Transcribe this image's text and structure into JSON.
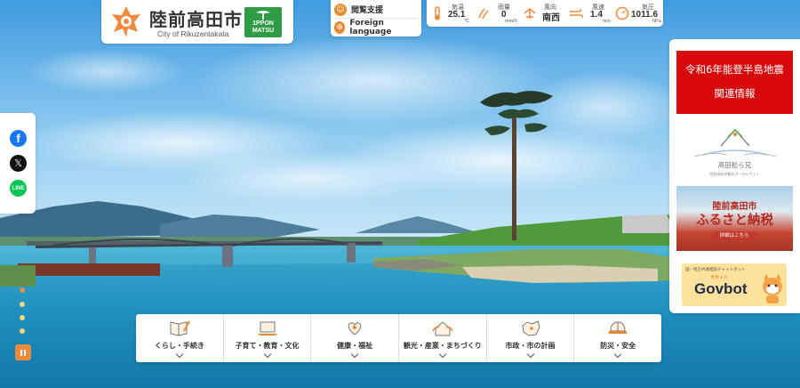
{
  "site": {
    "title": "陸前高田市",
    "subtitle": "City of Rikuzentakata",
    "ippon_line1": "1PPON",
    "ippon_line2": "MATSU"
  },
  "top_buttons": [
    {
      "label": "閲覧支援",
      "icon": "accessibility-icon"
    },
    {
      "label": "Foreign language",
      "icon": "globe-icon"
    }
  ],
  "weather": [
    {
      "label": "気温",
      "value": "25.1",
      "unit": "℃",
      "icon": "thermometer-icon"
    },
    {
      "label": "雨量",
      "value": "0",
      "unit": "mm/h",
      "icon": "rain-icon"
    },
    {
      "label": "風向",
      "value": "南西",
      "unit": "",
      "icon": "wind-direction-icon"
    },
    {
      "label": "風速",
      "value": "1.4",
      "unit": "m/s",
      "icon": "wind-icon"
    },
    {
      "label": "気圧",
      "value": "1011.6",
      "unit": "hPa",
      "icon": "pressure-icon"
    }
  ],
  "social": [
    {
      "name": "facebook",
      "glyph": "f"
    },
    {
      "name": "x",
      "glyph": "𝕏"
    },
    {
      "name": "line",
      "glyph": "LINE"
    }
  ],
  "slider": {
    "count": 4,
    "active_index": 0
  },
  "banners": {
    "quake_line1": "令和6年能登半島地震",
    "quake_line2": "関連情報",
    "takata_name": "高田松ら兄",
    "takata_sub": "陸前高田市観光ポータルサイト",
    "furusato_city": "陸前高田市",
    "furusato_title": "ふるさと納税",
    "furusato_button": "詳細はこちら",
    "govbot_top": "国・地方共通相談チャットボット",
    "govbot_ruby": "ガボット",
    "govbot_name": "Govbot"
  },
  "categories": [
    {
      "label": "くらし・手続き",
      "icon": "book-pen-icon"
    },
    {
      "label": "子育て・教育・文化",
      "icon": "laptop-icon"
    },
    {
      "label": "健康・福祉",
      "icon": "heart-hands-icon"
    },
    {
      "label": "観光・産業・まちづくり",
      "icon": "house-leaf-icon"
    },
    {
      "label": "市政・市の計画",
      "icon": "map-region-icon"
    },
    {
      "label": "防災・安全",
      "icon": "helmet-icon"
    }
  ],
  "colors": {
    "accent_orange": "#f08a3c",
    "quake_red": "#d7090b",
    "ippon_green": "#2e9b45"
  }
}
